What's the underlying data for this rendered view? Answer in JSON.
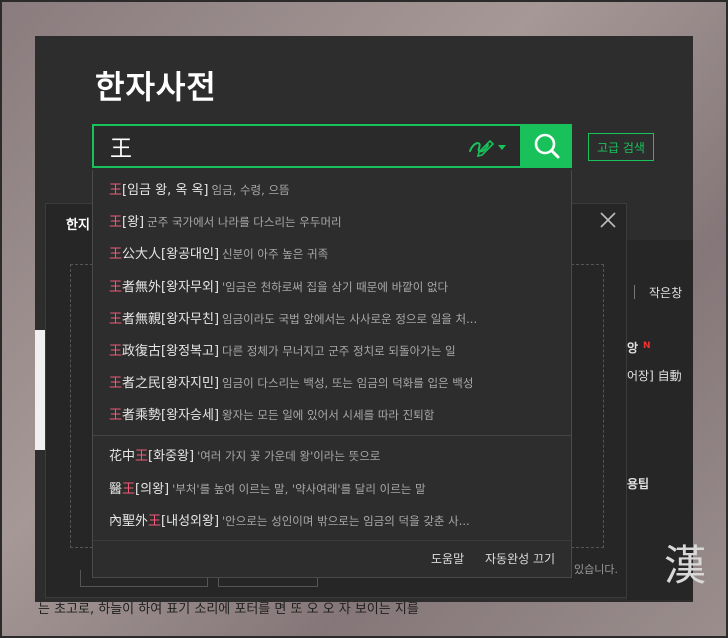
{
  "page": {
    "title": "한자사전",
    "advanced_search": "고급 검색"
  },
  "search": {
    "query": "王",
    "placeholder": ""
  },
  "suggestions": [
    {
      "pre": "",
      "hl": "王",
      "post": "",
      "reading": "[임금 왕, 옥 옥]",
      "desc": "임금, 수령, 으뜸"
    },
    {
      "pre": "",
      "hl": "王",
      "post": "",
      "reading": "[왕]",
      "desc": "군주 국가에서 나라를 다스리는 우두머리"
    },
    {
      "pre": "",
      "hl": "王",
      "post": "公大人",
      "reading": "[왕공대인]",
      "desc": "신분이 아주 높은 귀족"
    },
    {
      "pre": "",
      "hl": "王",
      "post": "者無外",
      "reading": "[왕자무외]",
      "desc": "'임금은 천하로써 집을 삼기 때문에 바깥이 없다"
    },
    {
      "pre": "",
      "hl": "王",
      "post": "者無親",
      "reading": "[왕자무친]",
      "desc": "임금이라도 국법 앞에서는 사사로운 정으로 일을 처..."
    },
    {
      "pre": "",
      "hl": "王",
      "post": "政復古",
      "reading": "[왕정복고]",
      "desc": "다른 정체가 무너지고 군주 정치로 되돌아가는 일"
    },
    {
      "pre": "",
      "hl": "王",
      "post": "者之民",
      "reading": "[왕자지민]",
      "desc": "임금이 다스리는 백성, 또는 임금의 덕화를 입은 백성"
    },
    {
      "pre": "",
      "hl": "王",
      "post": "者乘勢",
      "reading": "[왕자승세]",
      "desc": "왕자는 모든 일에 있어서 시세를 따라 진퇴함"
    }
  ],
  "contains": [
    {
      "pre": "花中",
      "hl": "王",
      "post": "",
      "reading": "[화중왕]",
      "desc": "'여러 가지 꽃 가운데 왕'이라는 뜻으로"
    },
    {
      "pre": "醫",
      "hl": "王",
      "post": "",
      "reading": "[의왕]",
      "desc": "'부처'를 높여 이르는 말, '약사여래'를 달리 이르는 말"
    },
    {
      "pre": "內聖外",
      "hl": "王",
      "post": "",
      "reading": "[내성외왕]",
      "desc": "'안으로는 성인이며 밖으로는 임금의 덕을 갖춘 사..."
    }
  ],
  "dropdown_footer": {
    "help": "도움말",
    "autocomplete_off": "자동완성 끄기"
  },
  "background": {
    "popup_title": "한지",
    "small_window": "작은창",
    "word_suffix": "앙",
    "new_badge": "N",
    "line": "어장] 自動",
    "tip": "용팁",
    "footer_text": "있습니다.",
    "big_char": "漢",
    "bottom_text": "는 초고로, 하늘이 하여 표기 소리에 포터를 면 또 오 오 자 보이는 지를"
  },
  "colors": {
    "accent": "#19c15b",
    "highlight": "#f05a78",
    "panel_bg": "#2d2d2d"
  },
  "icons": {
    "search": "search-icon",
    "handwriting": "handwriting-icon",
    "dropdown": "chevron-down-icon",
    "close": "close-icon"
  }
}
